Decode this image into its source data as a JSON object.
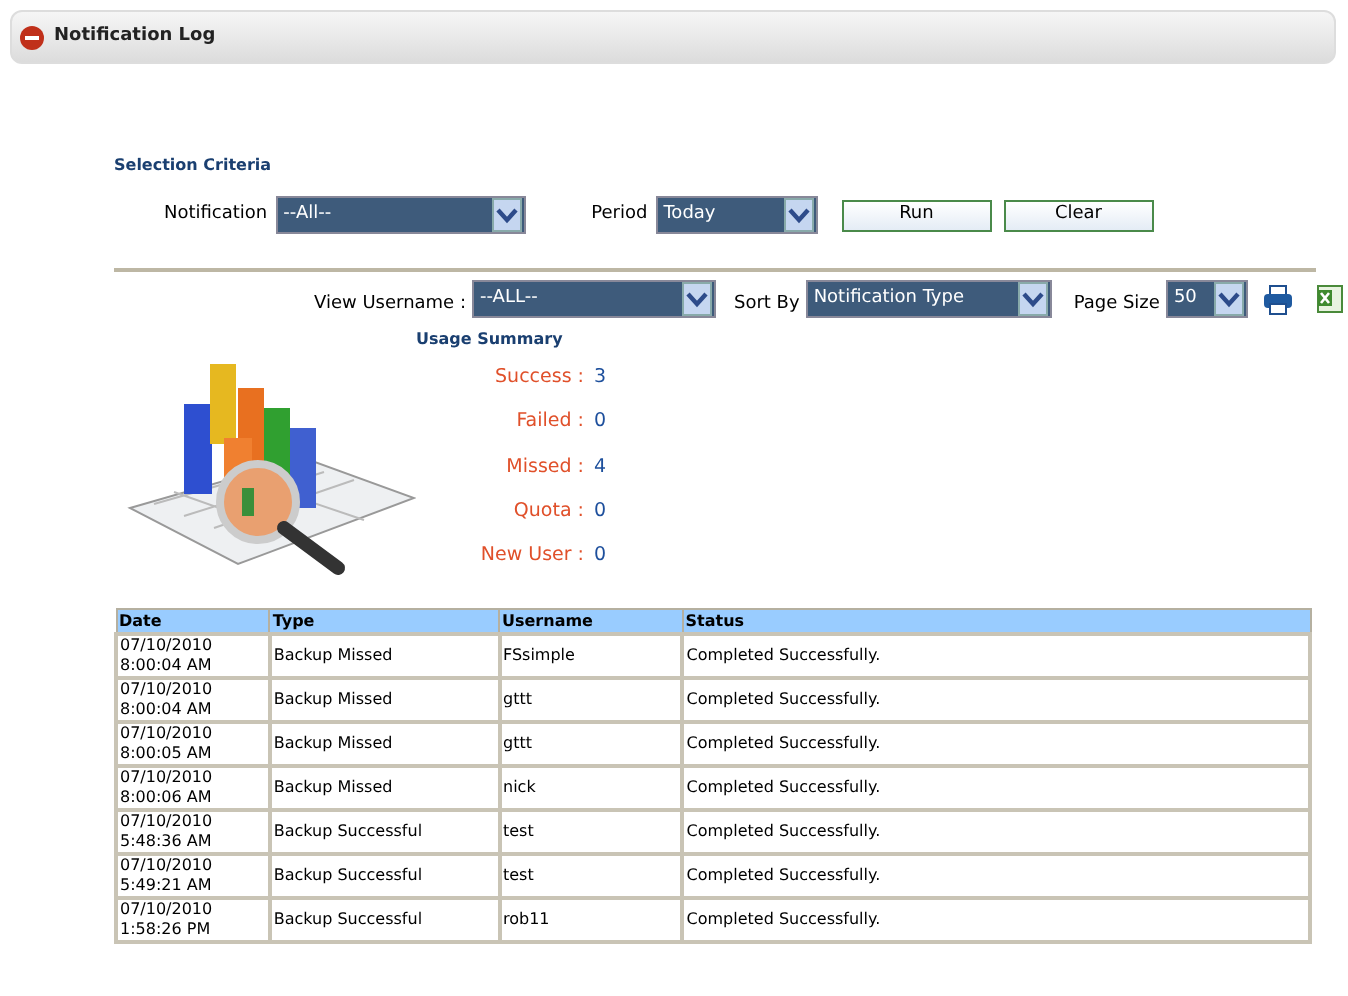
{
  "panel": {
    "title": "Notification Log",
    "expanded": true
  },
  "selection_criteria": {
    "title": "Selection Criteria",
    "fields": [
      {
        "label": "Notification",
        "value": "--All--"
      },
      {
        "label": "Period",
        "value": "Today"
      }
    ],
    "buttons": [
      "Run",
      "Clear"
    ]
  },
  "toolbar": {
    "fields": [
      {
        "label": "View Username :",
        "value": "--ALL--"
      },
      {
        "label": "Sort By",
        "value": "Notification Type"
      },
      {
        "label": "Page Size",
        "value": "50"
      }
    ]
  },
  "usage_summary": {
    "title": "Usage Summary",
    "stats": [
      {
        "label": "Success :",
        "value": "3"
      },
      {
        "label": "Failed :",
        "value": "0"
      },
      {
        "label": "Missed :",
        "value": "4"
      },
      {
        "label": "Quota :",
        "value": "0"
      },
      {
        "label": "New User :",
        "value": "0"
      }
    ]
  },
  "table": {
    "columns": [
      "Date",
      "Type",
      "Username",
      "Status"
    ],
    "rows": [
      [
        "07/10/2010 8:00:04 AM",
        "Backup Missed",
        "FSsimple",
        "Completed Successfully."
      ],
      [
        "07/10/2010 8:00:04 AM",
        "Backup Missed",
        "gttt",
        "Completed Successfully."
      ],
      [
        "07/10/2010 8:00:05 AM",
        "Backup Missed",
        "gttt",
        "Completed Successfully."
      ],
      [
        "07/10/2010 8:00:06 AM",
        "Backup Missed",
        "nick",
        "Completed Successfully."
      ],
      [
        "07/10/2010 5:48:36 AM",
        "Backup Successful",
        "test",
        "Completed Successfully."
      ],
      [
        "07/10/2010 5:49:21 AM",
        "Backup Successful",
        "test",
        "Completed Successfully."
      ],
      [
        "07/10/2010 1:58:26 PM",
        "Backup Successful",
        "rob11",
        "Completed Successfully."
      ]
    ]
  }
}
